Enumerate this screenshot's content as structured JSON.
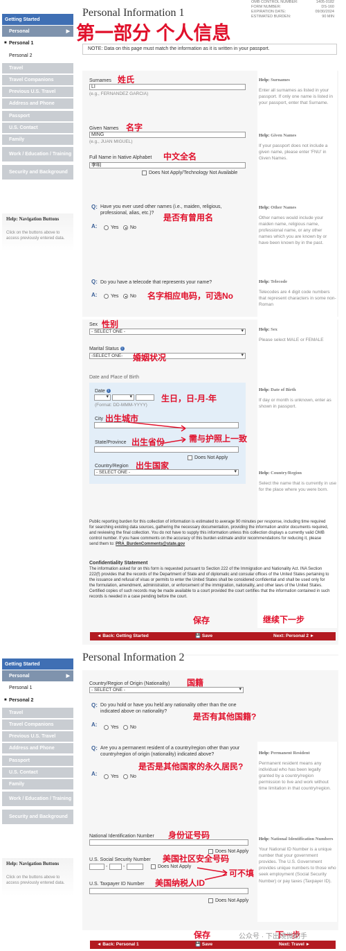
{
  "omb": {
    "control_label": "OMB CONTROL NUMBER:",
    "control_value": "1405-0182",
    "form_label": "FORM NUMBER:",
    "form_value": "DS-160",
    "exp_label": "EXPIRATION DATE:",
    "exp_value": "09/30/2024",
    "burden_label": "ESTIMATED BURDEN:",
    "burden_value": "90 MIN"
  },
  "nav": {
    "items": [
      "Getting Started",
      "Personal",
      "Personal 1",
      "Personal 2",
      "Travel",
      "Travel Companions",
      "Previous U.S. Travel",
      "Address and Phone",
      "Passport",
      "U.S. Contact",
      "Family",
      "Work / Education / Training",
      "Security and Background"
    ],
    "help_title": "Help: Navigation Buttons",
    "help_text": "Click on the buttons above to access previously entered data."
  },
  "page1": {
    "title": "Personal Information 1",
    "banner": "第一部分 个人信息",
    "note": "NOTE: Data on this page must match the information as it is written in your passport.",
    "surnames": {
      "label": "Surnames",
      "value": "LI",
      "hint": "(e.g., FERNANDEZ GARCIA)",
      "cn": "姓氏"
    },
    "given": {
      "label": "Given Names",
      "value": "MING",
      "hint": "(e.g., JUAN MIGUEL)",
      "cn": "名字"
    },
    "native": {
      "label": "Full Name in Native Alphabet",
      "value": "李明",
      "cn": "中文全名",
      "na": "Does Not Apply/Technology Not Available"
    },
    "q1": {
      "text": "Have you ever used other names (i.e., maiden, religious, professional, alias, etc.)?",
      "cn": "是否有曾用名"
    },
    "q2": {
      "text": "Do you have a telecode that represents your name?",
      "cn": "名字相应电码，可选No"
    },
    "yes": "Yes",
    "no": "No",
    "q_label": "Q:",
    "a_label": "A:",
    "help": [
      {
        "title": "Surnames",
        "text": "Enter all surnames as listed in your passport. If only one name is listed in your passport, enter that Surname."
      },
      {
        "title": "Given Names",
        "text": "If your passport does not include a given name, please enter 'FNU' in Given Names."
      },
      {
        "title": "Other Names",
        "text": "Other names would include your maiden name, religious name, professional name, or any other names which you are known by or have been known by in the past."
      },
      {
        "title": "Telecode",
        "text": "Telecodes are 4 digit code numbers that represent characters in some non-Roman"
      },
      {
        "title": "Sex",
        "text": "Please select MALE or FEMALE"
      },
      {
        "title": "Date of Birth",
        "text": "If day or month is unknown, enter as shown in passport."
      },
      {
        "title": "Country/Region",
        "text": "Select the name that is currently in use for the place where you were born."
      }
    ],
    "help_prefix": "Help:",
    "sex": {
      "label": "Sex",
      "value": "- SELECT ONE -",
      "cn": "性别"
    },
    "marital": {
      "label": "Marital Status",
      "value": "-SELECT ONE-",
      "cn": "婚姻状况"
    },
    "pob_heading": "Date and Place of Birth",
    "dob": {
      "label": "Date",
      "format": "(Format: DD-MMM-YYYY)",
      "cn": "生日，日-月-年"
    },
    "city": {
      "label": "City",
      "cn": "出生城市"
    },
    "state": {
      "label": "State/Province",
      "cn": "出生省份",
      "na": "Does Not Apply"
    },
    "match_cn": "需与护照上一致",
    "country": {
      "label": "Country/Region",
      "value": "- SELECT ONE -",
      "cn": "出生国家"
    },
    "burden": "Public reporting burden for this collection of information is estimated to average 90 minutes per response, including time required for searching existing data sources, gathering the necessary documentation, providing the information and/or documents required, and reviewing the final collection. You do not have to supply this information unless this collection displays a currently valid OMB control number. If you have comments on the accuracy of this burden estimate and/or recommendations for reducing it, please send them to:",
    "burden_email": "PRA_BurdenComments@state.gov",
    "conf_title": "Confidentiality Statement",
    "conf_text": "The information asked for on this form is requested pursuant to Section 222 of the Immigration and Nationality Act. INA Section 222(f) provides that the records of the Department of State and of diplomatic and consular offices of the United States pertaining to the issuance and refusal of visas or permits to enter the United States shall be considered confidential and shall be used only for the formulation, amendment, administration, or enforcement of the immigration, nationality, and other laws of the United States. Certified copies of such records may be made available to a court provided the court certifies that the information contained in such records is needed in a case pending before the court.",
    "btn_back": "◄ Back: Getting Started",
    "btn_save": "Save",
    "btn_next": "Next: Personal 2 ►",
    "save_cn": "保存",
    "next_cn": "继续下一步"
  },
  "page2": {
    "title": "Personal Information 2",
    "nationality": {
      "label": "Country/Region of Origin (Nationality)",
      "value": "- SELECT ONE -",
      "cn": "国籍"
    },
    "q1": {
      "text": "Do you hold or have you held any nationality other than the one indicated above on nationality?",
      "cn": "是否有其他国籍?"
    },
    "q2": {
      "text": "Are you a permanent resident of a country/region other than your country/region of origin (nationality) indicated above?",
      "cn": "是否是其他国家的永久居民?"
    },
    "nid": {
      "label": "National Identification Number",
      "cn": "身份证号码",
      "na": "Does Not Apply"
    },
    "ssn": {
      "label": "U.S. Social Security Number",
      "cn": "美国社区安全号码",
      "na": "Does Not Apply"
    },
    "tin": {
      "label": "U.S. Taxpayer ID Number",
      "cn": "美国纳税人ID",
      "na": "Does Not Apply"
    },
    "optional_cn": "可不填",
    "help": [
      {
        "title": "Permanent Resident",
        "text": "Permanent resident means any individual who has been legally granted by a country/region permission to live and work without time limitation in that country/region."
      },
      {
        "title": "National Identification Numbers",
        "text": "Your National ID Number is a unique number that your government provides. The U.S. Government provides unique numbers to those who seek employment (Social Security Number) or pay taxes (Taxpayer ID)."
      }
    ],
    "btn_back": "◄ Back: Personal 1",
    "btn_save": "Save",
    "btn_next": "Next: Travel ►",
    "save_cn": "保存",
    "next_cn": "下一步"
  },
  "watermark": "公众号 · 下出境微助手"
}
